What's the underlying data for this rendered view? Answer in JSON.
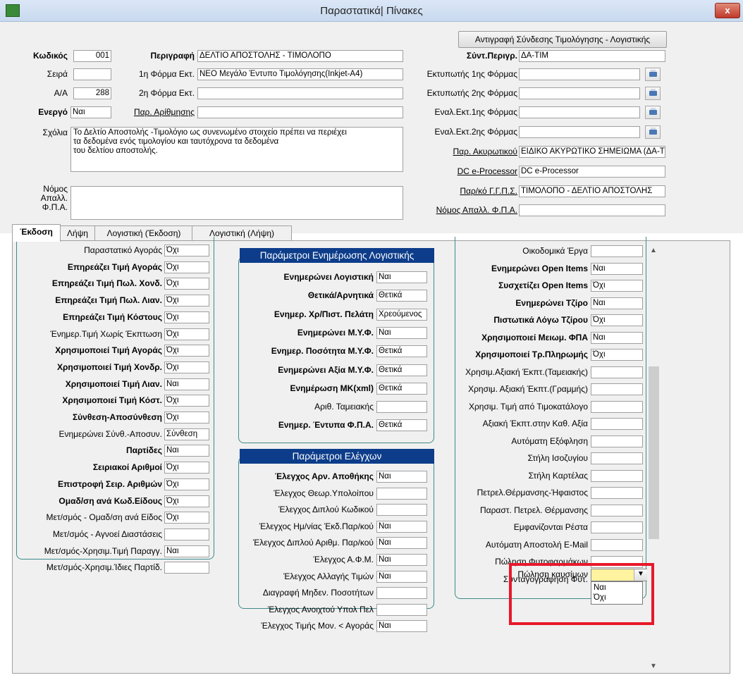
{
  "window": {
    "title": "Παραστατικά| Πίνακες",
    "close_glyph": "x",
    "app_icon": "app-icon"
  },
  "header": {
    "copy_button": "Αντιγραφή Σύνδεσης Τιμολόγησης - Λογιστικής",
    "code_label": "Κωδικός",
    "code_value": "001",
    "description_label": "Περιγραφή",
    "description_value": "ΔΕΛΤΙΟ ΑΠΟΣΤΟΛΗΣ - ΤΙΜΟΛΟΠΟ",
    "short_desc_label": "Σύντ.Περιγρ.",
    "short_desc_value": "ΔΑ-ΤΙΜ",
    "series_label": "Σειρά",
    "series_value": "",
    "form1_label": "1η Φόρμα Εκτ.",
    "form1_value": "ΝΕΟ Μεγάλο Έντυπο Τιμολόγησης(Inkjet-A4)",
    "printer1_label": "Εκτυπωτής 1ης Φόρμας",
    "printer1_value": "",
    "aa_label": "Α/Α",
    "aa_value": "288",
    "form2_label": "2η Φόρμα Εκτ.",
    "form2_value": "",
    "printer2_label": "Εκτυπωτής 2ης Φόρμας",
    "printer2_value": "",
    "active_label": "Ενεργό",
    "active_value": "Ναι",
    "numbering_label": "Παρ. Αρίθμησης",
    "numbering_value": "",
    "alt_printer1_label": "Εναλ.Εκτ.1ης Φόρμας",
    "alt_printer1_value": "",
    "alt_printer2_label": "Εναλ.Εκτ.2ης Φόρμας",
    "alt_printer2_value": "",
    "comments_label": "Σχόλια",
    "comments_lines": [
      "Το Δελτίο Αποστολής -Τιμολόγιο ως συνενωμένο στοιχείο πρέπει να περιέχει",
      "τα δεδομένα ενός τιμολογίου και ταυτόχρονα τα δεδομένα",
      "του δελτίου αποστολής."
    ],
    "cancel_doc_label": "Παρ. Ακυρωτικού",
    "cancel_doc_value": "ΕΙΔΙΚΟ ΑΚΥΡΩΤΙΚΟ ΣΗΜΕΙΩΜΑ (ΔΑ-Τ",
    "dc_label": "DC e-Processor",
    "dc_value": "DC e-Processor",
    "ggps_label": "Παρ/κό Γ.Γ.Π.Σ.",
    "ggps_value": "ΤΙΜΟΛΟΠΟ - ΔΕΛΤΙΟ ΑΠΟΣΤΟΛΗΣ",
    "vat_law_label_lines": [
      "Νόμος",
      "Απαλλ.",
      "Φ.Π.Α."
    ],
    "vat_law_value": "",
    "vat_law2_label": "Νόμος Απαλλ. Φ.Π.Α.",
    "vat_law2_value": "",
    "printer_icon": "printer-icon"
  },
  "tabs": [
    "Έκδοση",
    "Λήψη",
    "Λογιστική (Έκδοση)",
    "Λογιστική (Λήψη)"
  ],
  "left_column": [
    {
      "label": "Παραστατικό Αγοράς",
      "value": "Όχι",
      "bold": false
    },
    {
      "label": "Επηρεάζει Τιμή Αγοράς",
      "value": "Όχι",
      "bold": true
    },
    {
      "label": "Επηρεάζει Τιμή Πωλ. Χονδ.",
      "value": "Όχι",
      "bold": true
    },
    {
      "label": "Επηρεάζει Τιμή Πωλ. Λιαν.",
      "value": "Όχι",
      "bold": true
    },
    {
      "label": "Επηρεάζει Τιμή Κόστους",
      "value": "Όχι",
      "bold": true
    },
    {
      "label": "Ένημερ.Τιμή Χωρίς Έκπτωση",
      "value": "Όχι",
      "bold": false
    },
    {
      "label": "Χρησιμοποιεί Τιμή Αγοράς",
      "value": "Όχι",
      "bold": true
    },
    {
      "label": "Χρησιμοποιεί Τιμή Χονδρ.",
      "value": "Όχι",
      "bold": true
    },
    {
      "label": "Χρησιμοποιεί Τιμή Λιαν.",
      "value": "Ναι",
      "bold": true
    },
    {
      "label": "Χρησιμοποιεί Τιμή Κόστ.",
      "value": "Όχι",
      "bold": true
    },
    {
      "label": "Σύνθεση-Αποσύνθεση",
      "value": "Όχι",
      "bold": true
    },
    {
      "label": "Ενημερώνει Σύνθ.-Αποσυν.",
      "value": "Σύνθεση",
      "bold": false
    },
    {
      "label": "Παρτίδες",
      "value": "Ναι",
      "bold": true
    },
    {
      "label": "Σειριακοί Αριθμοί",
      "value": "Όχι",
      "bold": true
    },
    {
      "label": "Επιστροφή Σειρ. Αριθμών",
      "value": "Όχι",
      "bold": true
    },
    {
      "label": "Ομαδ/ση ανά Κωδ.Είδους",
      "value": "Όχι",
      "bold": true
    },
    {
      "label": "Μετ/σμός - Ομαδ/ση ανά Είδος",
      "value": "Όχι",
      "bold": false
    },
    {
      "label": "Μετ/σμός - Αγνοεί Διαστάσεις",
      "value": "",
      "bold": false
    },
    {
      "label": "Μετ/σμός-Χρησιμ.Τιμή Παραγγ.",
      "value": "Ναι",
      "bold": false
    },
    {
      "label": "Μετ/σμός-Χρησιμ.Ίδιες Παρτίδ.",
      "value": "",
      "bold": false
    }
  ],
  "accounting_group": {
    "title": "Παράμετροι Ενημέρωσης Λογιστικής",
    "rows": [
      {
        "label": "Ενημερώνει Λογιστική",
        "value": "Ναι",
        "bold": true
      },
      {
        "label": "Θετικά/Αρνητικά",
        "value": "Θετικά",
        "bold": true
      },
      {
        "label": "Ενημερ. Χρ/Πιστ. Πελάτη",
        "value": "Χρεούμενος",
        "bold": true
      },
      {
        "label": "Ενημερώνει Μ.Υ.Φ.",
        "value": "Ναι",
        "bold": true
      },
      {
        "label": "Ενημερ. Ποσότητα Μ.Υ.Φ.",
        "value": "Θετικά",
        "bold": true
      },
      {
        "label": "Ενημερώνει  Αξία Μ.Υ.Φ.",
        "value": "Θετικά",
        "bold": true
      },
      {
        "label": "Ενημέρωση ΜΚ(xml)",
        "value": "Θετικά",
        "bold": true
      },
      {
        "label": "Αριθ. Ταμειακής",
        "value": "",
        "bold": false
      },
      {
        "label": "Ενημερ. Έντυπα Φ.Π.Α.",
        "value": "Θετικά",
        "bold": true
      }
    ]
  },
  "checks_group": {
    "title": "Παράμετροι Ελέγχων",
    "rows": [
      {
        "label": "Έλεγχος Αρν. Αποθήκης",
        "value": "Ναι",
        "bold": true
      },
      {
        "label": "Έλεγχος Θεωρ.Υπολοίπου",
        "value": "",
        "bold": false
      },
      {
        "label": "Έλεγχος Διπλού Κωδικού",
        "value": "",
        "bold": false
      },
      {
        "label": "Έλεγχος Ημ/νίας  Έκδ.Παρ/κού",
        "value": "Ναι",
        "bold": false
      },
      {
        "label": "Έλεγχος Διπλού Αριθμ. Παρ/κού",
        "value": "Ναι",
        "bold": false
      },
      {
        "label": "Έλεγχος Α.Φ.Μ.",
        "value": "Ναι",
        "bold": false
      },
      {
        "label": "Έλεγχος Αλλαγής Τιμών",
        "value": "Ναι",
        "bold": false
      },
      {
        "label": "Διαγραφή Μηδεν. Ποσοτήτων",
        "value": "",
        "bold": false
      },
      {
        "label": "Έλεγχος Ανοιχτού Υπολ Πελ",
        "value": "",
        "bold": false
      },
      {
        "label": "Έλεγχος Τιμής Μον. < Αγοράς",
        "value": "Ναι",
        "bold": false
      }
    ]
  },
  "right_column": [
    {
      "label": "Οικοδομικά Έργα",
      "value": "",
      "bold": false
    },
    {
      "label": "Ενημερώνει Open Items",
      "value": "Ναι",
      "bold": true
    },
    {
      "label": "Συσχετίζει Open Items",
      "value": "Όχι",
      "bold": true
    },
    {
      "label": "Ενημερώνει Τζίρο",
      "value": "Ναι",
      "bold": true
    },
    {
      "label": "Πιστωτικά Λόγω Τζίρου",
      "value": "Όχι",
      "bold": true
    },
    {
      "label": "Χρησιμοποιεί Μειωμ. ΦΠΑ",
      "value": "Ναι",
      "bold": true
    },
    {
      "label": "Χρησιμοποιεί Τρ.Πληρωμής",
      "value": "Όχι",
      "bold": true
    },
    {
      "label": "Χρησιμ.Αξιακή Έκπτ.(Ταμειακής)",
      "value": "",
      "bold": false
    },
    {
      "label": "Χρησιμ. Αξιακή Έκπτ.(Γραμμής)",
      "value": "",
      "bold": false
    },
    {
      "label": "Χρησιμ. Τιμή από Τιμοκατάλογο",
      "value": "",
      "bold": false
    },
    {
      "label": "Αξιακή  Έκπτ.στην Καθ. Αξία",
      "value": "",
      "bold": false
    },
    {
      "label": "Αυτόματη Εξόφληση",
      "value": "",
      "bold": false
    },
    {
      "label": "Στήλη Ισοζυγίου",
      "value": "",
      "bold": false
    },
    {
      "label": "Στήλη Καρτέλας",
      "value": "",
      "bold": false
    },
    {
      "label": "Πετρελ.Θέρμανσης-Ήφαιστος",
      "value": "",
      "bold": false
    },
    {
      "label": "Παραστ. Πετρελ. Θέρμανσης",
      "value": "",
      "bold": false
    },
    {
      "label": "Εμφανίζονται Ρέστα",
      "value": "",
      "bold": false
    },
    {
      "label": "Αυτόματη Αποστολή E-Mail",
      "value": "",
      "bold": false
    },
    {
      "label": "Πώληση Φυτοφαρμάκων",
      "value": "",
      "bold": false
    },
    {
      "label": "Συνταγογράφηση Φυτ.",
      "value": "",
      "bold": false
    }
  ],
  "fuel": {
    "label": "Πώληση καυσίμων",
    "value": "",
    "options": [
      "Ναι",
      "Όχι"
    ],
    "highlight_color": "#e8182b",
    "combo_color": "#fff3a0"
  },
  "scrollbar": {
    "up": "▲",
    "down": "▼"
  },
  "colors": {
    "group_header": "#0d3d8a",
    "group_border": "#3f8a8a"
  }
}
